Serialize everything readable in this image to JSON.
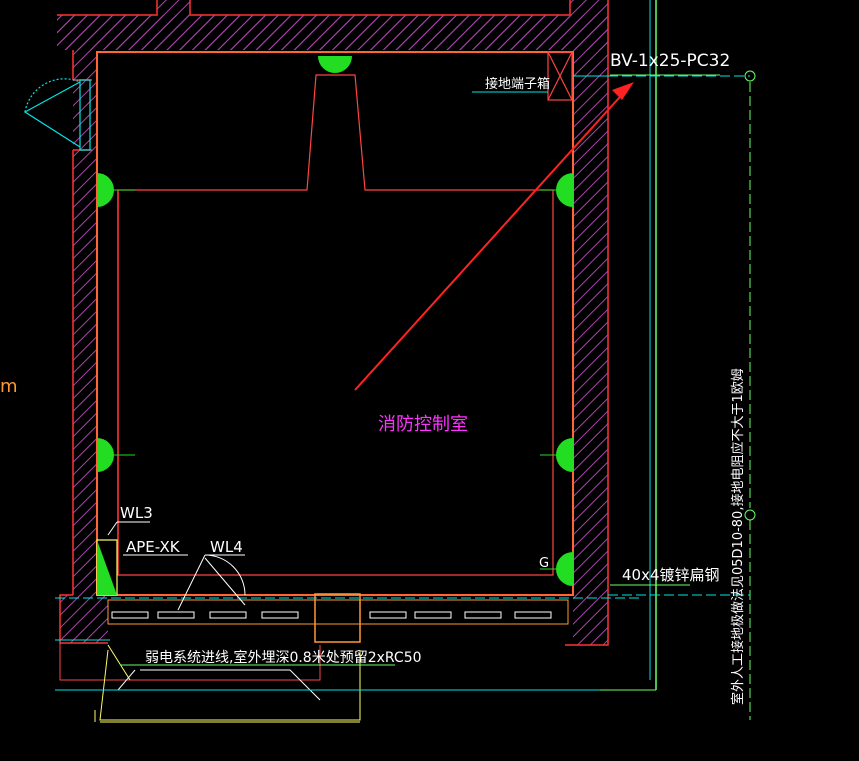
{
  "labels": {
    "cable_spec": "BV-1x25-PC32",
    "grounding_box": "接地端子箱",
    "room_name": "消防控制室",
    "circuit_wl3": "WL3",
    "panel_ape": "APE-XK",
    "circuit_wl4": "WL4",
    "flat_steel": "40x4镀锌扁钢",
    "weak_current_note": "弱电系统进线,室外埋深0.8米处预留2xRC50",
    "vertical_note": "室外人工接地极做法见05D10-80,接地电阻应不大于1欧姆",
    "socket_g": "G",
    "left_edge_char": "m"
  },
  "colors": {
    "background": "#000000",
    "wall": "#ff3333",
    "hatch": "#aa44aa",
    "label": "#ffffff",
    "room_name": "#ff33ff",
    "cyan_line": "#00e5e5",
    "green_line": "#66ff66",
    "fixture": "#22dd22",
    "yellow_line": "#ffff66",
    "orange_line": "#ff9933",
    "arrow": "#ff2222"
  },
  "icons": {
    "fixture": "half-circle-wall-light-icon",
    "door": "door-swing-icon",
    "arrow": "annotation-arrow-icon",
    "grounding_box": "x-box-icon"
  }
}
